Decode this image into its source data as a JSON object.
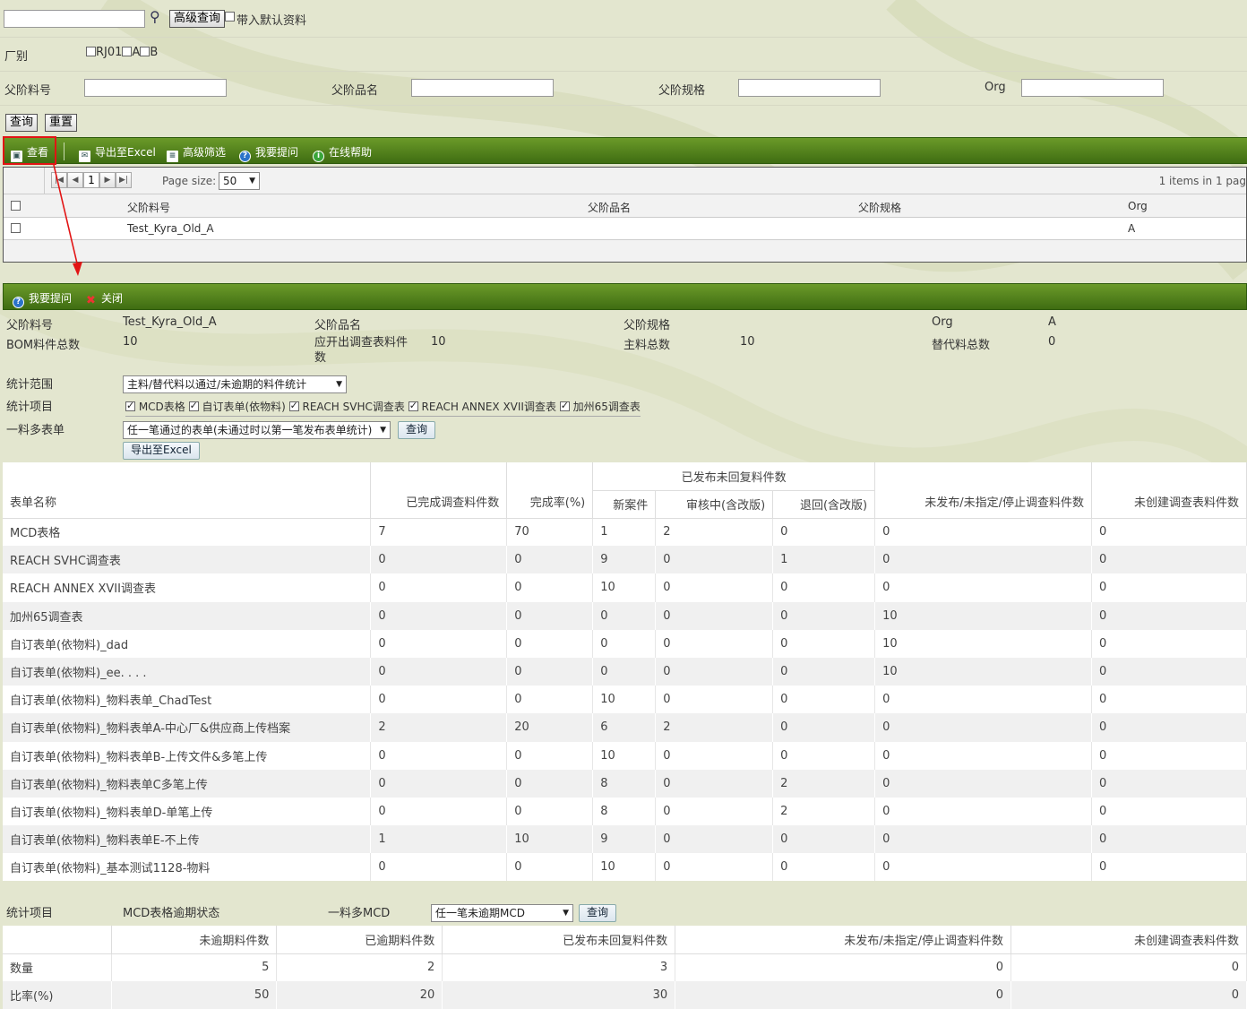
{
  "search": {
    "button_label": "高级查询",
    "default_checkbox_label": "带入默认资料"
  },
  "factory": {
    "label": "厂别",
    "options": [
      "RJ01",
      "A",
      "B"
    ]
  },
  "filters": {
    "labels": [
      "父阶料号",
      "父阶品名",
      "父阶规格",
      "Org"
    ]
  },
  "actions": {
    "query_label": "查询",
    "reset_label": "重置"
  },
  "toolbar": {
    "view": "查看",
    "export": "导出至Excel",
    "filter": "高级筛选",
    "ask": "我要提问",
    "help": "在线帮助"
  },
  "pager": {
    "current_page": "1",
    "page_size_label": "Page size:",
    "page_size": "50",
    "info": "1 items in 1 pag"
  },
  "grid": {
    "columns": [
      "父阶料号",
      "父阶品名",
      "父阶规格",
      "Org"
    ],
    "rows": [
      {
        "part": "Test_Kyra_Old_A",
        "name": "",
        "spec": "",
        "org": "A"
      }
    ]
  },
  "detail_toolbar": {
    "ask": "我要提问",
    "close": "关闭"
  },
  "detail": {
    "parent_part_label": "父阶料号",
    "parent_part": "Test_Kyra_Old_A",
    "parent_name_label": "父阶品名",
    "parent_name": "",
    "parent_spec_label": "父阶规格",
    "parent_spec": "",
    "org_label": "Org",
    "org": "A",
    "bom_total_label": "BOM料件总数",
    "bom_total": "10",
    "survey_needed_label": "应开出调查表料件数",
    "survey_needed": "10",
    "main_total_label": "主料总数",
    "main_total": "10",
    "sub_total_label": "替代料总数",
    "sub_total": "0"
  },
  "scope": {
    "label": "统计范围",
    "value": "主料/替代料以通过/未逾期的料件统计",
    "items_label": "统计项目",
    "items": [
      "MCD表格",
      "自订表单(依物料)",
      "REACH SVHC调查表",
      "REACH ANNEX XVII调查表",
      "加州65调查表"
    ],
    "multi_label": "一料多表单",
    "multi_value": "任一笔通过的表单(未通过时以第一笔发布表单统计)",
    "query_label": "查询",
    "export_label": "导出至Excel"
  },
  "stats_table": {
    "group_header": "已发布未回复料件数",
    "headers": [
      "表单名称",
      "已完成调查料件数",
      "完成率(%)",
      "新案件",
      "审核中(含改版)",
      "退回(含改版)",
      "未发布/未指定/停止调查料件数",
      "未创建调查表料件数"
    ],
    "rows": [
      [
        "MCD表格",
        "7",
        "70",
        "1",
        "2",
        "0",
        "0",
        "0"
      ],
      [
        "REACH SVHC调查表",
        "0",
        "0",
        "9",
        "0",
        "1",
        "0",
        "0"
      ],
      [
        "REACH ANNEX XVII调查表",
        "0",
        "0",
        "10",
        "0",
        "0",
        "0",
        "0"
      ],
      [
        "加州65调查表",
        "0",
        "0",
        "0",
        "0",
        "0",
        "10",
        "0"
      ],
      [
        "自订表单(依物料)_dad",
        "0",
        "0",
        "0",
        "0",
        "0",
        "10",
        "0"
      ],
      [
        "自订表单(依物料)_ee. . .  .",
        "0",
        "0",
        "0",
        "0",
        "0",
        "10",
        "0"
      ],
      [
        "自订表单(依物料)_物料表单_ChadTest",
        "0",
        "0",
        "10",
        "0",
        "0",
        "0",
        "0"
      ],
      [
        "自订表单(依物料)_物料表单A-中心厂&供应商上传档案",
        "2",
        "20",
        "6",
        "2",
        "0",
        "0",
        "0"
      ],
      [
        "自订表单(依物料)_物料表单B-上传文件&多笔上传",
        "0",
        "0",
        "10",
        "0",
        "0",
        "0",
        "0"
      ],
      [
        "自订表单(依物料)_物料表单C多笔上传",
        "0",
        "0",
        "8",
        "0",
        "2",
        "0",
        "0"
      ],
      [
        "自订表单(依物料)_物料表单D-单笔上传",
        "0",
        "0",
        "8",
        "0",
        "2",
        "0",
        "0"
      ],
      [
        "自订表单(依物料)_物料表单E-不上传",
        "1",
        "10",
        "9",
        "0",
        "0",
        "0",
        "0"
      ],
      [
        "自订表单(依物料)_基本测试1128-物料",
        "0",
        "0",
        "10",
        "0",
        "0",
        "0",
        "0"
      ]
    ]
  },
  "mcd": {
    "items_label": "统计项目",
    "status_label": "MCD表格逾期状态",
    "multi_label": "一料多MCD",
    "multi_value": "任一笔未逾期MCD",
    "query_label": "查询",
    "headers": [
      "",
      "未逾期料件数",
      "已逾期料件数",
      "已发布未回复料件数",
      "未发布/未指定/停止调查料件数",
      "未创建调查表料件数"
    ],
    "rows": [
      [
        "数量",
        "5",
        "2",
        "3",
        "0",
        "0"
      ],
      [
        "比率(%)",
        "50",
        "20",
        "30",
        "0",
        "0"
      ]
    ]
  },
  "colors": {
    "toolbar_green": "#4f7f1c",
    "highlight_red": "#e21414",
    "page_bg": "#e3e6cf"
  }
}
